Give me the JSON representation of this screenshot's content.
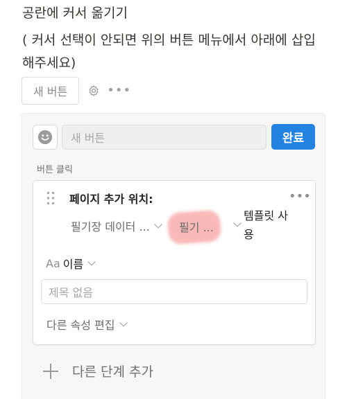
{
  "text": {
    "line1": "공란에 커서 옮기기",
    "line2": "( 커서 선택이 안되면 위의 버튼 메뉴에서 아래에 삽입해주세요)"
  },
  "button_block": {
    "label": "새 버튼",
    "more": "•••"
  },
  "editor": {
    "name_placeholder": "새 버튼",
    "done_label": "완료",
    "trigger_label": "버튼 클릭",
    "accent_color": "#2383e2"
  },
  "action": {
    "title": "페이지 추가 위치:",
    "more": "•••",
    "database": "필기장 데이터 ...",
    "page": "필기 ...",
    "template": "템플릿 사용",
    "highlight_color": "#f8a8a8"
  },
  "property": {
    "type_glyph": "Aa",
    "name": "이름",
    "title_placeholder": "제목 없음",
    "edit_other": "다른 속성 편집"
  },
  "footer": {
    "add_step": "다른 단계 추가"
  }
}
